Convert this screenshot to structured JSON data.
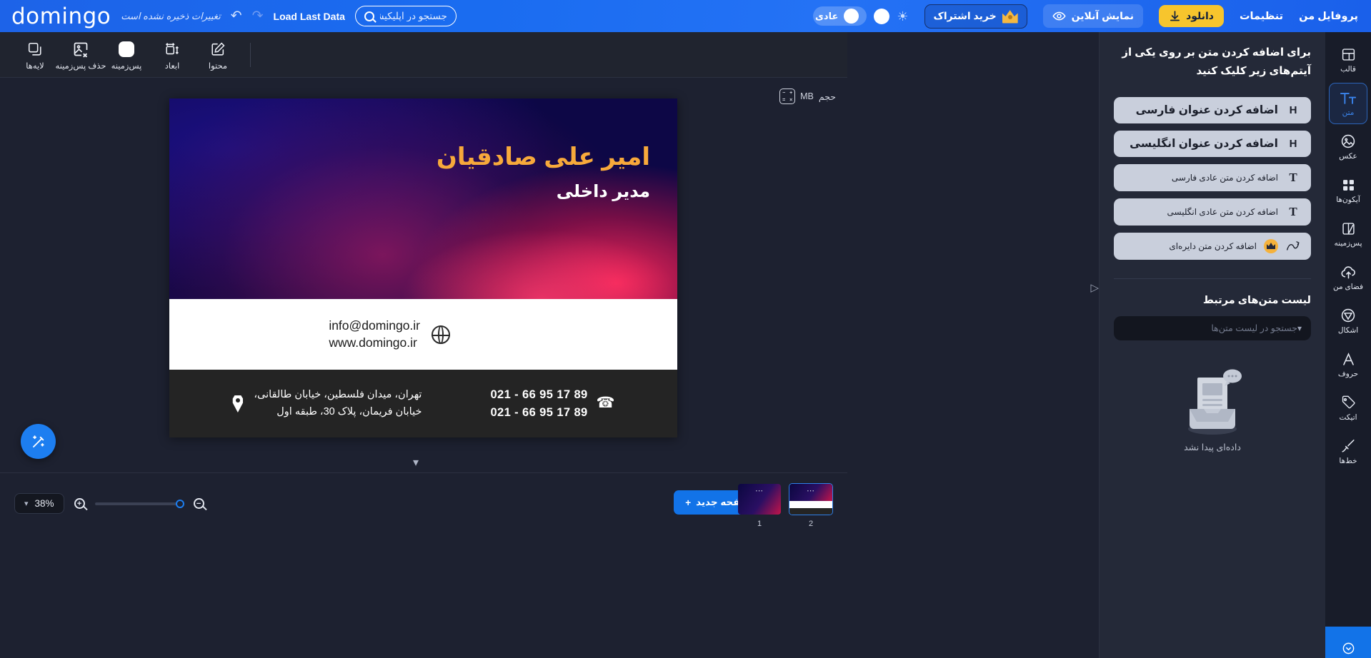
{
  "header": {
    "logo": "domingo",
    "unsaved_text": "تغییرات ذخیره نشده است",
    "undo_icon": "undo-arrow-icon",
    "redo_icon": "redo-arrow-icon",
    "load_last_data": "Load Last Data",
    "search_placeholder": "جستجو در اپلیکیشن...",
    "search_value": "",
    "theme_light_icon": "sun-icon",
    "mode_pill_label": "عادی",
    "subscribe_label": "خرید اشتراک",
    "preview_label": "نمایش آنلاین",
    "download_label": "دانلود",
    "settings_label": "تنظیمات",
    "profile_label": "پروفایل من",
    "accent_blue": "#1a6cf0",
    "download_yellow": "#f7c52d",
    "crown_gold": "#f5b841"
  },
  "toolbar": {
    "items": [
      {
        "label": "لایه‌ها",
        "icon": "layers-icon"
      },
      {
        "label": "حذف پس‌زمینه",
        "icon": "remove-background-icon"
      },
      {
        "label": "پس‌زمینه",
        "icon": "background-color-icon"
      },
      {
        "label": "ابعاد",
        "icon": "dimensions-icon"
      },
      {
        "label": "محتوا",
        "icon": "content-edit-icon"
      }
    ]
  },
  "canvas": {
    "size_label": "حجم",
    "size_unit": "MB",
    "size_icon": "calculator-icon",
    "magic_icon": "magic-wand-icon",
    "collapse_icon": "chevron-down-icon",
    "slide": {
      "name": "امیر علی صادقیان",
      "role": "مدیر داخلی",
      "email": "info@domingo.ir",
      "website": "www.domingo.ir",
      "address_line1": "تهران، میدان فلسطین، خیابان طالقانی،",
      "address_line2": "خیابان فریمان، پلاک 30، طبقه اول",
      "phone_line1": "021 - 66 95 17 89",
      "phone_line2": "021 - 66 95 17 89",
      "name_color": "#f7a93b",
      "globe_icon": "globe-icon",
      "pin_icon": "location-pin-icon",
      "phone_icon": "phone-icon"
    }
  },
  "bottom": {
    "zoom_value": "38%",
    "zoom_dropdown_icon": "chevron-down-icon",
    "zoom_in_icon": "zoom-in-icon",
    "zoom_out_icon": "zoom-out-icon",
    "slider_position_percent": 88,
    "new_page_label": "صفحه جدید",
    "new_page_icon": "plus-icon",
    "pages": [
      {
        "number": "1",
        "selected": false,
        "menu_icon": "more-dots-icon"
      },
      {
        "number": "2",
        "selected": true,
        "menu_icon": "more-dots-icon"
      }
    ]
  },
  "right_panel": {
    "title": "برای اضافه کردن متن بر روی یکی از آیتم‌های زیر کلیک کنید",
    "actions": [
      {
        "label": "اضافه کردن عنوان فارسی",
        "icon": "heading-h-icon",
        "size": "big",
        "premium": false
      },
      {
        "label": "اضافه کردن عنوان انگلیسی",
        "icon": "heading-h-icon",
        "size": "big",
        "premium": false
      },
      {
        "label": "اضافه کردن متن عادی فارسی",
        "icon": "text-t-icon",
        "size": "small",
        "premium": false
      },
      {
        "label": "اضافه کردن متن عادی انگلیسی",
        "icon": "text-t-icon",
        "size": "small",
        "premium": false
      },
      {
        "label": "اضافه کردن متن دایره‌ای",
        "icon": "curved-text-icon",
        "size": "small",
        "premium": true
      }
    ],
    "related_title": "لیست متن‌های مرتبط",
    "search_placeholder": "جستجو در لیست متن‌ها",
    "search_value": "",
    "search_dropdown_icon": "chevron-down-icon",
    "empty_caption": "داده‌ای پیدا نشد",
    "empty_icon": "no-data-illustration",
    "collapse_handle_icon": "panel-collapse-arrow-icon"
  },
  "right_rail": {
    "items": [
      {
        "label": "قالب",
        "icon": "template-icon",
        "active": false
      },
      {
        "label": "متن",
        "icon": "text-tool-icon",
        "active": true
      },
      {
        "label": "عکس",
        "icon": "image-icon",
        "active": false
      },
      {
        "label": "آیکون‌ها",
        "icon": "icons-grid-icon",
        "active": false
      },
      {
        "label": "پس‌زمینه",
        "icon": "background-icon",
        "active": false
      },
      {
        "label": "فضای من",
        "icon": "cloud-upload-icon",
        "active": false
      },
      {
        "label": "اشکال",
        "icon": "shapes-icon",
        "active": false
      },
      {
        "label": "حروف",
        "icon": "letters-a-icon",
        "active": false
      },
      {
        "label": "اتیکت",
        "icon": "tag-icon",
        "active": false
      },
      {
        "label": "خط‌ها",
        "icon": "lines-brush-icon",
        "active": false
      }
    ],
    "active_color": "#3b86ef"
  }
}
